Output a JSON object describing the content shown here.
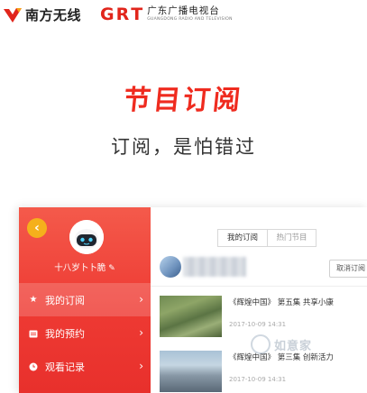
{
  "header": {
    "nanfang_logo_text": "南方无线",
    "grt_letters": [
      "G",
      "R",
      "T"
    ],
    "grt_cn": "广东广播电视台",
    "grt_en": "GUANGDONG RADIO AND TELEVISION"
  },
  "hero": {
    "title": "节目订阅",
    "subtitle": "订阅，是怕错过"
  },
  "sidebar": {
    "user_name": "十八岁卜卜脆",
    "items": [
      {
        "label": "我的订阅",
        "icon": "star-icon",
        "active": true
      },
      {
        "label": "我的预约",
        "icon": "calendar-icon",
        "active": false
      },
      {
        "label": "观看记录",
        "icon": "clock-icon",
        "active": false
      }
    ]
  },
  "content": {
    "tabs": [
      {
        "label": "我的订阅",
        "active": true
      },
      {
        "label": "热门节目",
        "active": false
      }
    ],
    "unsubscribe_label": "取消订阅",
    "programs": [
      {
        "title": "《辉煌中国》 第五集 共享小康",
        "time": "2017-10-09 14:31"
      },
      {
        "title": "《辉煌中国》 第三集 创新活力",
        "time": "2017-10-09 14:31"
      }
    ]
  },
  "watermark": {
    "text": "如意家"
  },
  "colors": {
    "brand_red": "#ef2b1f",
    "sidebar_red": "#ee3a33",
    "back_button_yellow": "#f5b01c"
  }
}
